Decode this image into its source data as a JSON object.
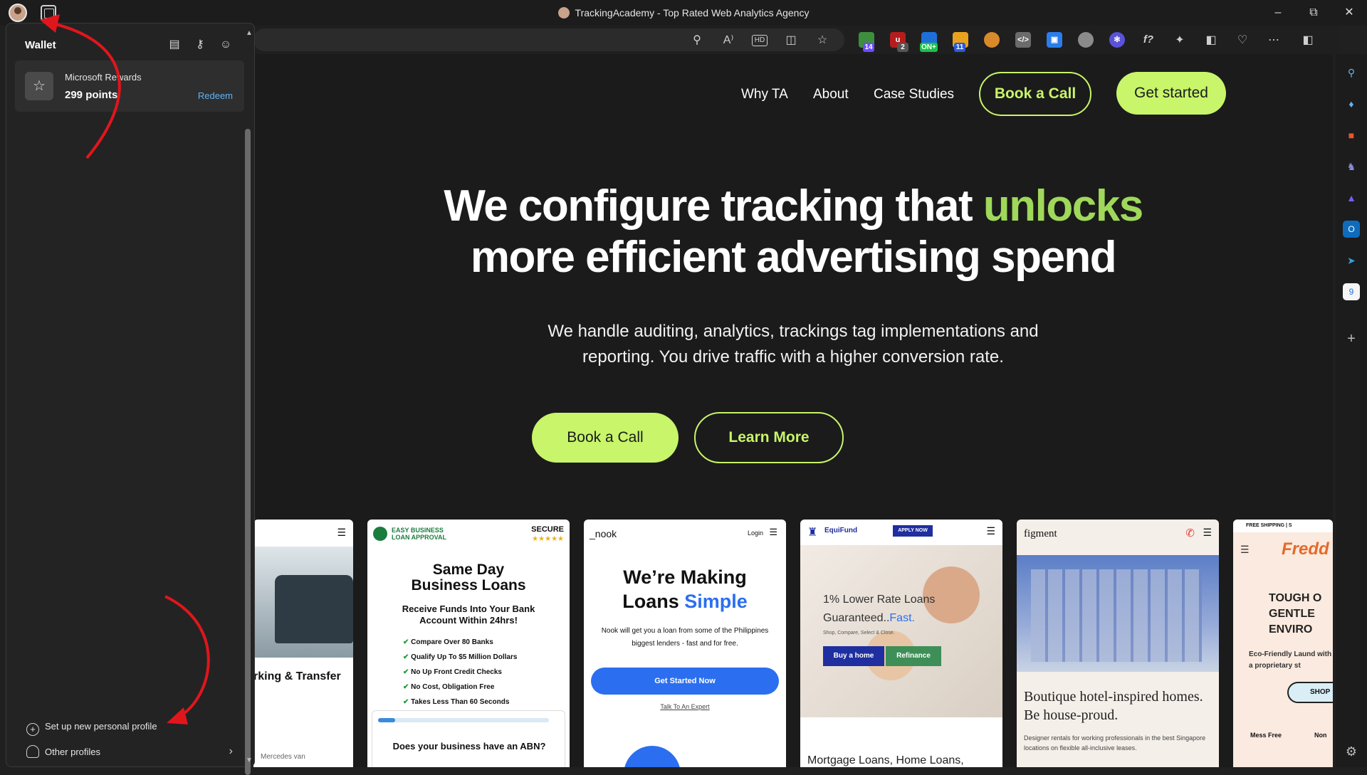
{
  "window": {
    "title": "TrackingAcademy - Top Rated Web Analytics Agency",
    "controls": [
      "minimize-icon",
      "restore-icon",
      "close-icon"
    ]
  },
  "toolbar": {
    "address_icons": [
      "zoom-icon",
      "read-aloud-icon",
      "hd-icon",
      "split-icon",
      "favorite-icon"
    ],
    "extensions": [
      {
        "name": "extension-green",
        "color": "#3d8f3d",
        "badge": "14",
        "badge_color": "#6a4cff"
      },
      {
        "name": "extension-ublock",
        "color": "#b51d1d",
        "badge": "2",
        "badge_color": "#555555"
      },
      {
        "name": "extension-on",
        "color": "#1e6fd9",
        "badge": "ON+",
        "badge_color": "#19c24a"
      },
      {
        "name": "extension-yellow",
        "color": "#e9a21d",
        "badge": "11",
        "badge_color": "#2a5bd7"
      },
      {
        "name": "extension-cookie",
        "color": "#d98a2b",
        "badge": "",
        "badge_color": ""
      },
      {
        "name": "extension-code",
        "color": "#6b6b6b",
        "badge": "",
        "badge_color": ""
      },
      {
        "name": "extension-blue-square",
        "color": "#2b7de9",
        "badge": "",
        "badge_color": ""
      },
      {
        "name": "extension-disc",
        "color": "#8b8b8b",
        "badge": "",
        "badge_color": ""
      },
      {
        "name": "extension-gear",
        "color": "#5a52d9",
        "badge": "",
        "badge_color": ""
      },
      {
        "name": "extension-fx",
        "color": "#d0d0d0",
        "badge": "",
        "badge_color": ""
      }
    ]
  },
  "flyout": {
    "header": "Wallet",
    "rewards_name": "Microsoft Rewards",
    "rewards_points": "299 points",
    "redeem": "Redeem",
    "setup_profile": "Set up new personal profile",
    "other_profiles": "Other profiles"
  },
  "site": {
    "nav": [
      "Why TA",
      "About",
      "Case Studies"
    ],
    "book_call": "Book a Call",
    "get_started": "Get started",
    "hero_line1": "We configure tracking that",
    "hero_accent": "unlocks",
    "hero_line2": "more efficient advertising spend",
    "hero_sub": "We handle auditing, analytics, trackings tag implementations and reporting. You drive traffic with a higher conversion rate.",
    "cta_book": "Book a Call",
    "cta_learn": "Learn More",
    "accent_color": "#c8f56a"
  },
  "cards": [
    {
      "caption": "rking & Transfer",
      "footer": "Mercedes van"
    },
    {
      "brand": "EASY BUSINESS LOAN APPROVAL",
      "secure": "SECURE",
      "title1": "Same Day",
      "title2": "Business Loans",
      "sub": "Receive Funds Into Your Bank Account Within 24hrs!",
      "checks": [
        "Compare Over 80 Banks",
        "Qualify Up To $5 Million Dollars",
        "No Up Front Credit Checks",
        "No Cost, Obligation Free",
        "Takes Less Than 60 Seconds"
      ],
      "question": "Does your business have an ABN?"
    },
    {
      "brand": "_nook",
      "login": "Login",
      "title1": "We’re Making",
      "title2": "Loans",
      "title_accent": "Simple",
      "body": "Nook will get you a loan from some of the Philippines biggest lenders - fast and for free.",
      "cta": "Get Started Now",
      "link": "Talk To An Expert"
    },
    {
      "brand": "EquiFund",
      "apply": "APPLY NOW",
      "head": "1% Lower Rate Loans",
      "head2": "Guaranteed..",
      "head2_accent": "Fast.",
      "tagline": "Shop, Compare, Select & Close.",
      "buy": "Buy a home",
      "refi": "Refinance",
      "foot": "Mortgage Loans, Home Loans,"
    },
    {
      "brand": "figment",
      "title": "Boutique hotel-inspired homes. Be house-proud.",
      "body": "Designer rentals for working professionals in the best Singapore locations on flexible all-inclusive leases."
    },
    {
      "top": "FREE SHIPPING | S",
      "brand": "Fredd",
      "h": "TOUGH O GENTLE ENVIRO",
      "sub": "Eco-Friendly Laund with a proprietary st",
      "shop": "SHOP",
      "f1": "Mess Free",
      "f2": "Non"
    }
  ]
}
